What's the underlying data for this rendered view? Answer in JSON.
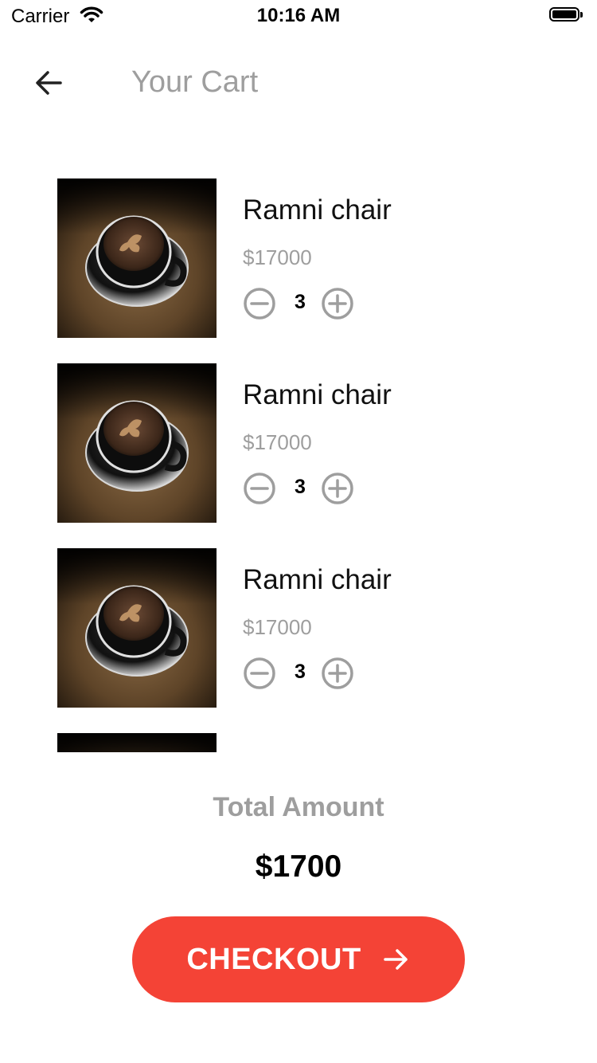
{
  "status_bar": {
    "carrier": "Carrier",
    "time": "10:16 AM"
  },
  "header": {
    "title": "Your Cart",
    "back_icon": "arrow-left-icon"
  },
  "cart": {
    "items": [
      {
        "name": "Ramni chair",
        "price": "$17000",
        "quantity": "3",
        "image": "coffee-cup-thumbnail"
      },
      {
        "name": "Ramni chair",
        "price": "$17000",
        "quantity": "3",
        "image": "coffee-cup-thumbnail"
      },
      {
        "name": "Ramni chair",
        "price": "$17000",
        "quantity": "3",
        "image": "coffee-cup-thumbnail"
      }
    ],
    "partial_item": {
      "image": "coffee-cup-thumbnail"
    }
  },
  "summary": {
    "total_label": "Total Amount",
    "total_value": "$1700"
  },
  "checkout": {
    "label": "CHECKOUT",
    "icon": "arrow-right-icon"
  },
  "colors": {
    "accent": "#f44336",
    "muted_text": "#9e9e9e",
    "background": "#ffffff"
  }
}
